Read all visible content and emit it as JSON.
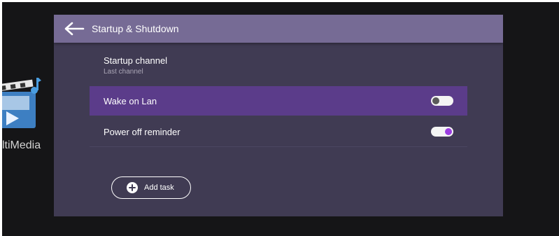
{
  "desktop": {
    "app_label": "ltiMedia"
  },
  "panel": {
    "title": "Startup & Shutdown"
  },
  "settings": {
    "startup_channel": {
      "label": "Startup channel",
      "value": "Last channel"
    },
    "wake_on_lan": {
      "label": "Wake on Lan",
      "enabled": false
    },
    "power_off_reminder": {
      "label": "Power off reminder",
      "enabled": true
    }
  },
  "add_task": {
    "label": "Add task"
  },
  "colors": {
    "panel_background": "#403b53",
    "header_background": "#766b95",
    "highlight_row": "#5b3c8a",
    "toggle_on_knob": "#9b3de0",
    "toggle_off_knob": "#5a5a5a"
  },
  "icons": {
    "back": "back-arrow-icon",
    "add": "plus-circle-icon",
    "app": "multimedia-app-icon"
  }
}
